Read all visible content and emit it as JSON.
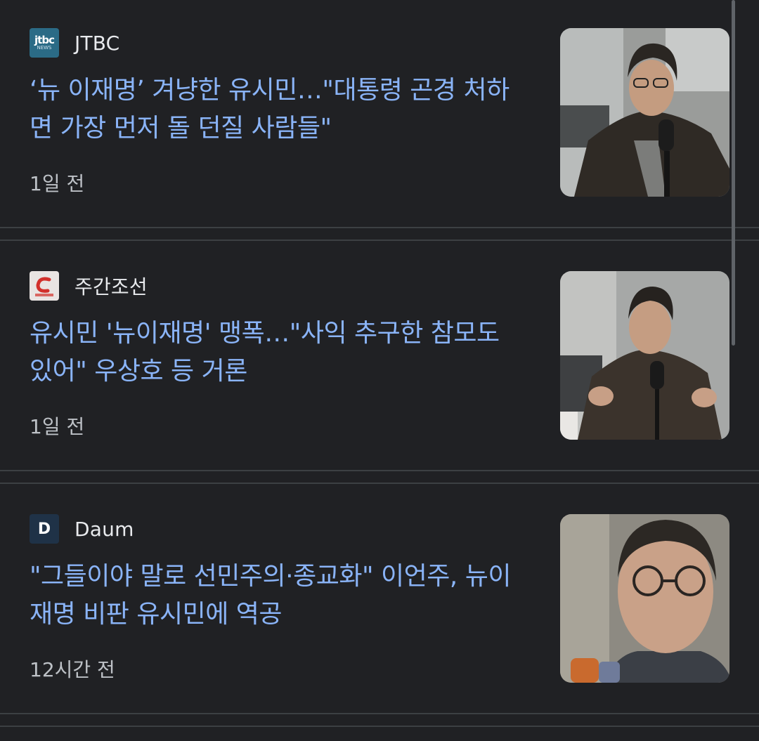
{
  "articles": [
    {
      "source": "JTBC",
      "source_logo_icon": "jtbc-logo-icon",
      "source_logo_text": "jtbc",
      "source_logo_subtext": "NEWS",
      "headline": "‘뉴 이재명’ 겨냥한 유시민…\"대통령 곤경 처하면 가장 먼저 돌 던질 사람들\"",
      "time": "1일 전"
    },
    {
      "source": "주간조선",
      "source_logo_icon": "chosun-logo-icon",
      "headline": "유시민 '뉴이재명' 맹폭…\"사익 추구한 참모도 있어\" 우상호 등 거론",
      "time": "1일 전"
    },
    {
      "source": "Daum",
      "source_logo_icon": "daum-logo-icon",
      "source_logo_text": "D",
      "headline": "\"그들이야 말로 선민주의·종교화\" 이언주, 뉴이재명 비판 유시민에 역공",
      "time": "12시간 전"
    }
  ],
  "colors": {
    "background": "#202124",
    "headline": "#8ab4f8",
    "source": "#e8eaed",
    "time": "#bdc1c6",
    "divider": "#3c4043"
  }
}
